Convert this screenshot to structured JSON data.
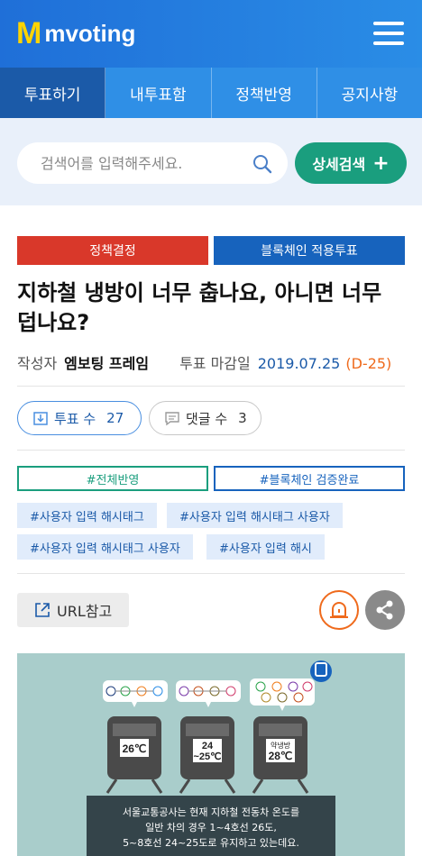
{
  "header": {
    "logo_mark": "M",
    "logo_text": "mvoting"
  },
  "tabs": [
    {
      "label": "투표하기",
      "active": true
    },
    {
      "label": "내투표함",
      "active": false
    },
    {
      "label": "정책반영",
      "active": false
    },
    {
      "label": "공지사항",
      "active": false
    }
  ],
  "search": {
    "placeholder": "검색어를 입력해주세요.",
    "advanced_label": "상세검색",
    "advanced_plus": "+"
  },
  "post": {
    "badges": [
      "정책결정",
      "블록체인 적용투표"
    ],
    "title": "지하철 냉방이 너무 춥나요, 아니면 너무 덥나요?",
    "author_label": "작성자",
    "author": "엠보팅 프레임",
    "deadline_label": "투표 마감일",
    "deadline": "2019.07.25",
    "dday": "(D-25)",
    "vote_label": "투표 수",
    "vote_count": "27",
    "comment_label": "댓글 수",
    "comment_count": "3",
    "outline_tags": [
      "#전체반영",
      "#블록체인 검증완료"
    ],
    "tags_row1": [
      "#사용자 입력 해시태그",
      "#사용자 입력 해시태그 사용자"
    ],
    "tags_row2": [
      "#사용자 입력 해시태그 사용자",
      "#사용자 입력 해시"
    ],
    "url_label": "URL참고"
  },
  "infographic": {
    "lines_a": [
      "①",
      "②",
      "③",
      "④"
    ],
    "lines_b": [
      "⑤",
      "⑥",
      "⑦",
      "⑧"
    ],
    "lines_c": [
      "②",
      "③",
      "⑤",
      "⑧",
      "⑨",
      "⑦",
      "⑥"
    ],
    "temp_a": "26℃",
    "temp_b_top": "24",
    "temp_b_bottom": "~25℃",
    "temp_c_top": "약냉방",
    "temp_c_bottom": "28℃",
    "text_line1": "서울교통공사는 현재 지하철 전동차 온도를",
    "text_line2": "일반 차의 경우 1~4호선 26도,",
    "text_line3": "5~8호선 24~25도로 유지하고 있는데요."
  },
  "colors": {
    "primary": "#1f6fd8",
    "tab_active": "#1b5aa8",
    "green": "#1a9e7e",
    "red": "#d9382a",
    "orange": "#ef6a1c"
  }
}
